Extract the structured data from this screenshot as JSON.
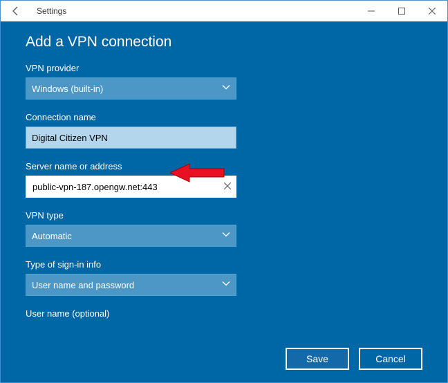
{
  "window": {
    "title": "Settings"
  },
  "modal": {
    "heading": "Add a VPN connection"
  },
  "fields": {
    "provider": {
      "label": "VPN provider",
      "value": "Windows (built-in)"
    },
    "connection_name": {
      "label": "Connection name",
      "value": "Digital Citizen VPN"
    },
    "server": {
      "label": "Server name or address",
      "value": "public-vpn-187.opengw.net:443"
    },
    "vpn_type": {
      "label": "VPN type",
      "value": "Automatic"
    },
    "signin": {
      "label": "Type of sign-in info",
      "value": "User name and password"
    },
    "username": {
      "label": "User name (optional)"
    }
  },
  "buttons": {
    "save": "Save",
    "cancel": "Cancel"
  }
}
